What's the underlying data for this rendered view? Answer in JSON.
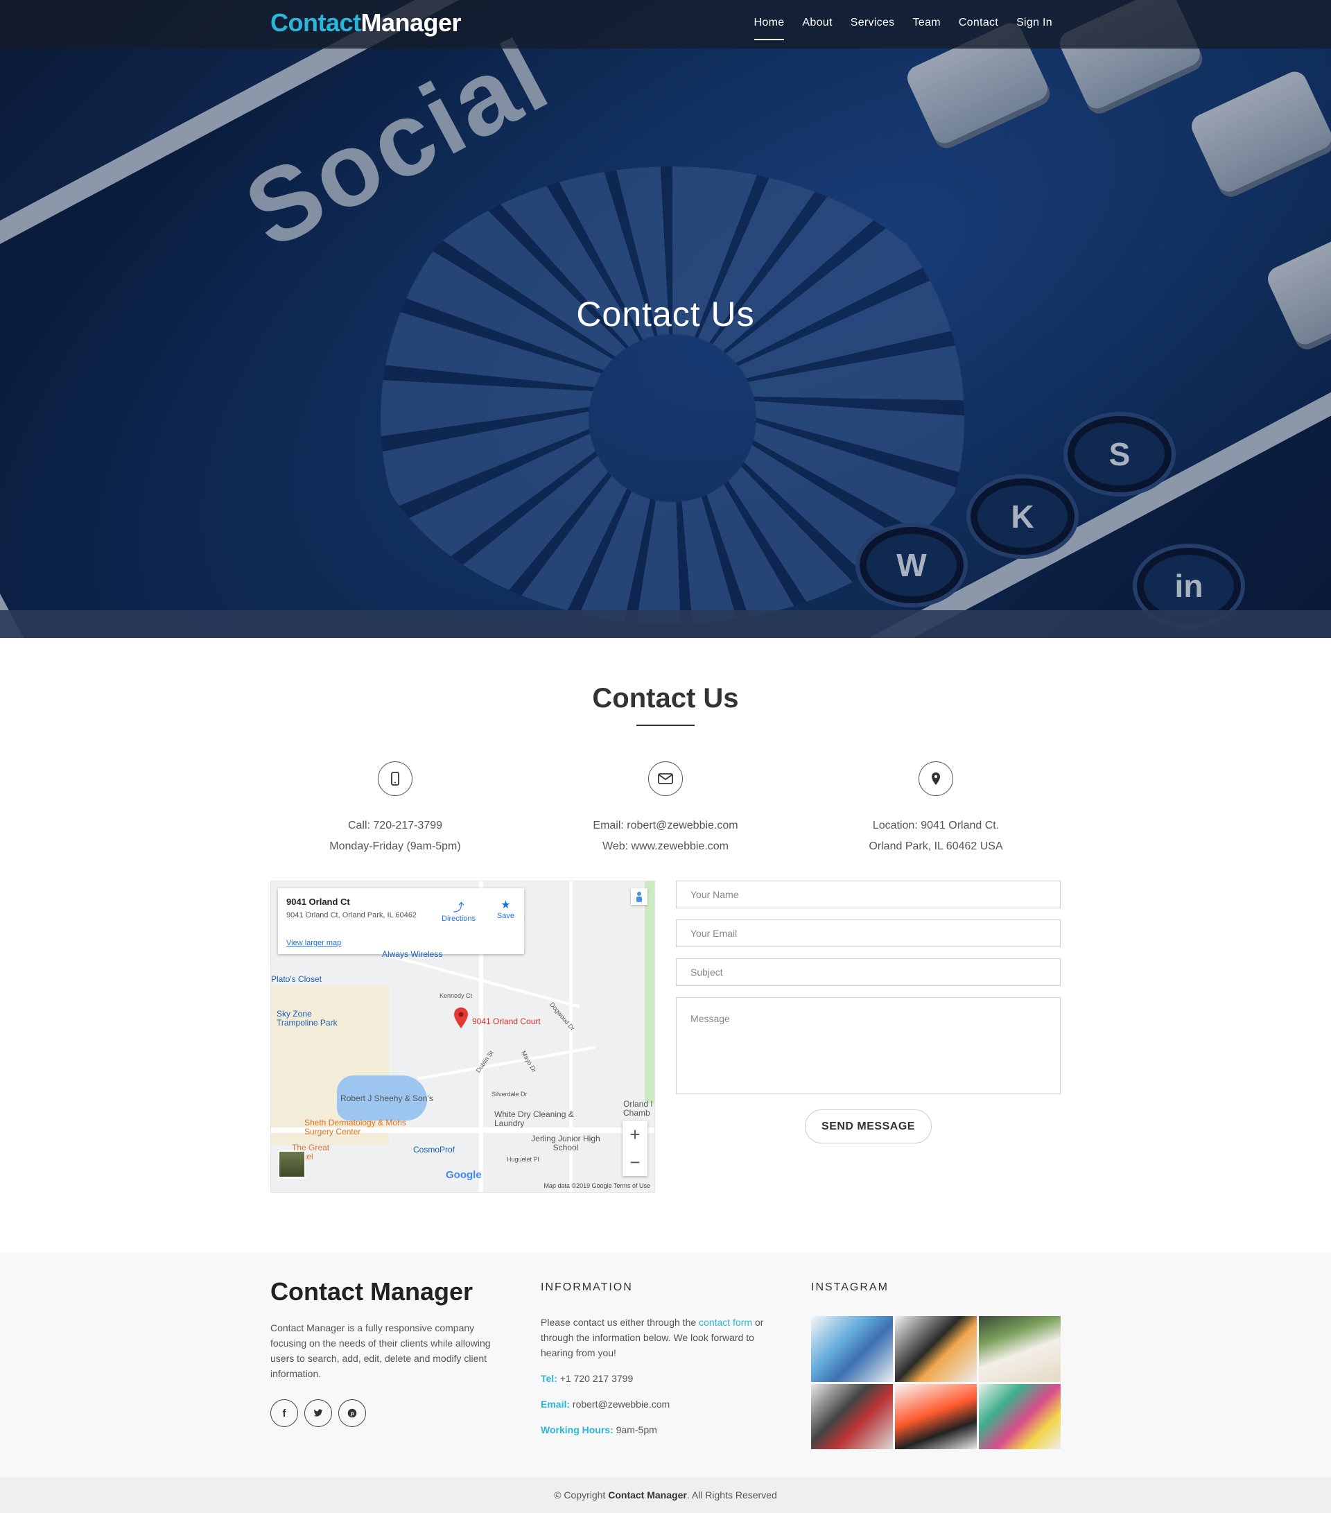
{
  "nav": {
    "logo_part1": "Contact",
    "logo_part2": "Manager",
    "items": [
      {
        "label": "Home",
        "active": true
      },
      {
        "label": "About"
      },
      {
        "label": "Services"
      },
      {
        "label": "Team"
      },
      {
        "label": "Contact"
      },
      {
        "label": "Sign In"
      }
    ]
  },
  "hero": {
    "title": "Contact Us",
    "bg_word": "Social"
  },
  "section": {
    "title": "Contact Us"
  },
  "info": [
    {
      "icon": "phone-icon",
      "line1": "Call: 720-217-3799",
      "line2": "Monday-Friday (9am-5pm)"
    },
    {
      "icon": "envelope-icon",
      "line1": "Email: robert@zewebbie.com",
      "line2": "Web: www.zewebbie.com"
    },
    {
      "icon": "location-pin-icon",
      "line1": "Location: 9041 Orland Ct.",
      "line2": "Orland Park, IL 60462 USA"
    }
  ],
  "map": {
    "card_title": "9041 Orland Ct",
    "card_address": "9041 Orland Ct, Orland Park, IL 60462",
    "directions": "Directions",
    "save": "Save",
    "larger": "View larger map",
    "labels": {
      "always_wireless": "Always Wireless",
      "platos": "Plato's Closet",
      "skyzone": "Sky Zone Trampoline Park",
      "kennedy": "Kennedy Ct",
      "orland_court": "9041 Orland Court",
      "dogwood": "Dogwood Dr",
      "dublin": "Dublin St",
      "mayo": "Mayo Dr",
      "sheehy": "Robert J Sheehy & Son's",
      "silverdale": "Silverdale Dr",
      "white_dry": "White Dry Cleaning & Laundry",
      "sheth": "Sheth Dermatology & Mohs Surgery Center",
      "great_bagel": "The Great Bagel",
      "cosmoprof": "CosmoProf",
      "jerling": "Jerling Junior High School",
      "orland_chamber": "Orland I Chamb",
      "huguelet": "Huguelet Pl",
      "google": "Google",
      "footer": "Map data ©2019 Google   Terms of Use"
    }
  },
  "form": {
    "name_ph": "Your Name",
    "email_ph": "Your Email",
    "subject_ph": "Subject",
    "message_ph": "Message",
    "send": "SEND MESSAGE"
  },
  "footer": {
    "brand": "Contact Manager",
    "desc": "Contact Manager is a fully responsive company focusing on the needs of their clients while allowing users to search, add, edit, delete and modify client information.",
    "info_head": "INFORMATION",
    "info_text_1": "Please contact us either through the ",
    "info_link": "contact form",
    "info_text_2": " or through the information below. We look forward to hearing from you!",
    "tel_label": "Tel:",
    "tel": " +1 720 217 3799",
    "email_label": "Email:",
    "email": " robert@zewebbie.com",
    "hours_label": "Working Hours:",
    "hours": " 9am-5pm",
    "insta_head": "INSTAGRAM",
    "copyright_pre": "© Copyright ",
    "copyright_brand": "Contact Manager",
    "copyright_post": ". All Rights Reserved"
  },
  "colors": {
    "accent": "#29b6d8",
    "hero_blue": "#173a73"
  }
}
